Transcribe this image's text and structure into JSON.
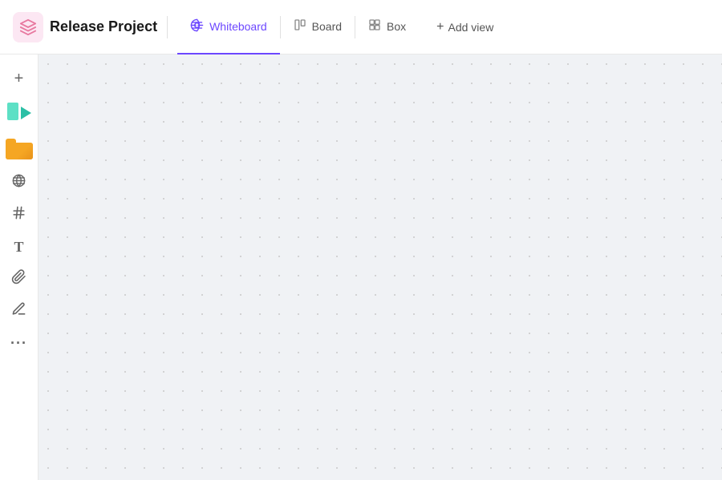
{
  "header": {
    "project_title": "Release Project",
    "tabs": [
      {
        "id": "whiteboard",
        "label": "Whiteboard",
        "icon": "whiteboard-icon",
        "active": true
      },
      {
        "id": "board",
        "label": "Board",
        "icon": "board-icon",
        "active": false
      },
      {
        "id": "box",
        "label": "Box",
        "icon": "box-icon",
        "active": false
      }
    ],
    "add_view_label": "Add view"
  },
  "sidebar": {
    "items": [
      {
        "id": "plus",
        "icon": "plus-icon",
        "label": "Add"
      },
      {
        "id": "media",
        "icon": "media-icon",
        "label": "Media"
      },
      {
        "id": "files",
        "icon": "files-icon",
        "label": "Files"
      },
      {
        "id": "globe",
        "icon": "globe-icon",
        "label": "Globe"
      },
      {
        "id": "hash",
        "icon": "hash-icon",
        "label": "Hash"
      },
      {
        "id": "text",
        "icon": "text-icon",
        "label": "Text"
      },
      {
        "id": "link",
        "icon": "link-icon",
        "label": "Link"
      },
      {
        "id": "pencil",
        "icon": "pencil-icon",
        "label": "Draw"
      },
      {
        "id": "more",
        "icon": "more-icon",
        "label": "More"
      }
    ]
  },
  "canvas": {
    "background_color": "#f0f2f5"
  }
}
